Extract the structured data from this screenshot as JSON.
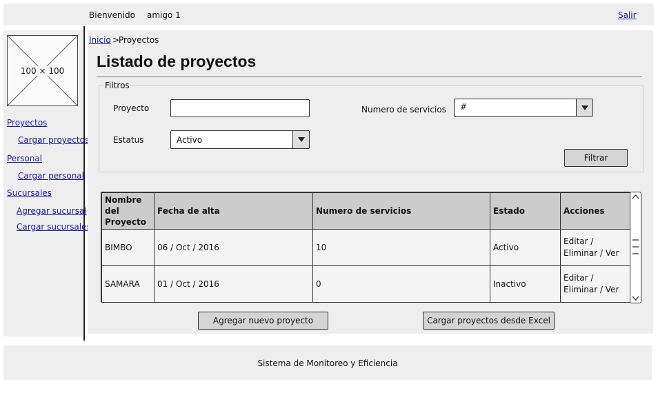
{
  "header": {
    "welcome": "Bienvenido",
    "user": "amigo 1",
    "logout": "Salir"
  },
  "sidebar": {
    "logo_placeholder": "100 × 100",
    "items": [
      {
        "label": "Proyectos"
      },
      {
        "label": "Cargar proyectos"
      },
      {
        "label": "Personal"
      },
      {
        "label": "Cargar personal"
      },
      {
        "label": "Sucursales"
      },
      {
        "label": "Agregar sucursal"
      },
      {
        "label": "Cargar sucursales"
      }
    ]
  },
  "breadcrumb": {
    "home": "Inicio",
    "separator": ">",
    "current": "Proyectos"
  },
  "page_title": "Listado de proyectos",
  "filters": {
    "legend": "Filtros",
    "proyecto_label": "Proyecto",
    "proyecto_value": "",
    "servicios_label": "Numero de servicios",
    "servicios_value": "#",
    "estatus_label": "Estatus",
    "estatus_value": "Activo",
    "filter_button": "Filtrar"
  },
  "table": {
    "headers": [
      "Nombre del Proyecto",
      "Fecha de alta",
      "Numero de servicios",
      "Estado",
      "Acciones"
    ],
    "rows": [
      {
        "nombre": "BIMBO",
        "fecha": "06 / Oct / 2016",
        "servicios": "10",
        "estado": "Activo",
        "acciones": "Editar / Eliminar / Ver"
      },
      {
        "nombre": "SAMARA",
        "fecha": "01 / Oct / 2016",
        "servicios": "0",
        "estado": "Inactivo",
        "acciones": "Editar / Eliminar / Ver"
      }
    ]
  },
  "actions": {
    "add_project": "Agregar nuevo proyecto",
    "load_excel": "Cargar proyectos desde Excel"
  },
  "footer": {
    "text": "Sistema de Monitoreo y Eficiencia"
  },
  "icons": {
    "dropdown": "chevron-down-icon",
    "scroll_up": "chevron-up-icon",
    "scroll_down": "chevron-down-icon",
    "scroll_thumb": "grip-icon",
    "logo": "image-placeholder-icon"
  }
}
